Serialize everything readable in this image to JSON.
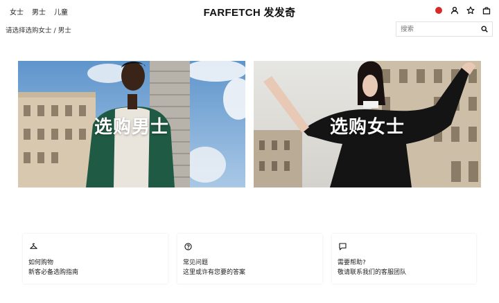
{
  "nav": {
    "items": [
      "女士",
      "男士",
      "儿童"
    ]
  },
  "logo": {
    "text": "FARFETCH 发发奇"
  },
  "header_icons": [
    "region-dot",
    "user-icon",
    "star-icon",
    "bag-icon"
  ],
  "breadcrumb": {
    "text": "请选择选购女士 / 男士"
  },
  "search": {
    "placeholder": "搜索",
    "icon": "search-icon"
  },
  "banners": {
    "men": {
      "title": "选购男士"
    },
    "women": {
      "title": "选购女士"
    }
  },
  "help_cards": [
    {
      "icon": "hanger-icon",
      "title": "如何购物",
      "subtitle": "新客必备选购指南"
    },
    {
      "icon": "question-icon",
      "title": "常见问题",
      "subtitle": "这里或许有您要的答案"
    },
    {
      "icon": "chat-icon",
      "title": "需要帮助?",
      "subtitle": "敬请联系我们的客服团队"
    }
  ],
  "colors": {
    "region_dot": "#d62a2a",
    "text": "#222222"
  }
}
